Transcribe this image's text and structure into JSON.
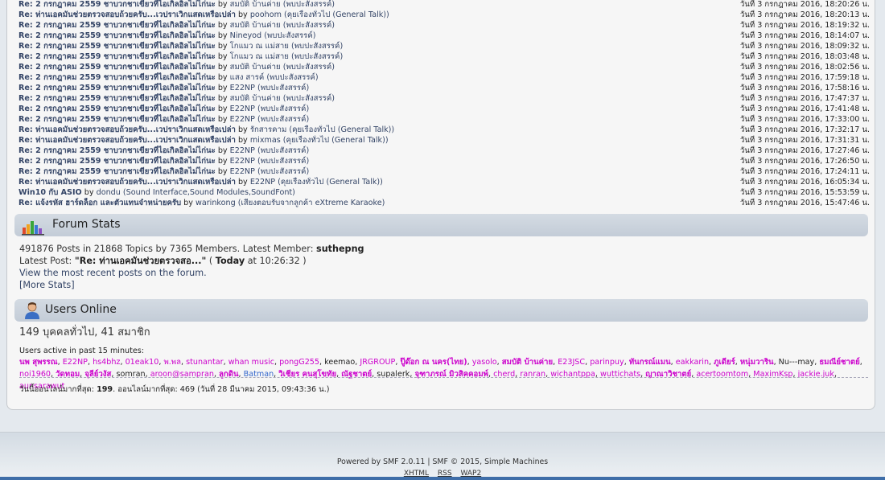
{
  "recent_posts": [
    {
      "title": "Re: 2 กรกฎาคม 2559 ชาบวกชาเขียวที่ไอเกิลอิลไม่ไก่นะ",
      "author": "สมบัติ บ้านค่าย",
      "board": "(พบปะสังสรรค์)",
      "time": "วันที่ 3 กรกฎาคม 2016, 18:20:26 น."
    },
    {
      "title": "Re: ท่านเอคมันช่วยตรวจสอบถ้วยครับ...เวปราเวิกแสดเหรือเปล่า",
      "author": "poohom",
      "board": "(คุยเรื่องทั่วไป (General Talk))",
      "time": "วันที่ 3 กรกฎาคม 2016, 18:20:13 น."
    },
    {
      "title": "Re: 2 กรกฎาคม 2559 ชาบวกชาเขียวที่ไอเกิลอิลไม่ไก่นะ",
      "author": "สมบัติ บ้านค่าย",
      "board": "(พบปะสังสรรค์)",
      "time": "วันที่ 3 กรกฎาคม 2016, 18:19:32 น."
    },
    {
      "title": "Re: 2 กรกฎาคม 2559 ชาบวกชาเขียวที่ไอเกิลอิลไม่ไก่นะ",
      "author": "Nineyod",
      "board": "(พบปะสังสรรค์)",
      "time": "วันที่ 3 กรกฎาคม 2016, 18:14:07 น."
    },
    {
      "title": "Re: 2 กรกฎาคม 2559 ชาบวกชาเขียวที่ไอเกิลอิลไม่ไก่นะ",
      "author": "โกแมว ณ แม่สาย",
      "board": "(พบปะสังสรรค์)",
      "time": "วันที่ 3 กรกฎาคม 2016, 18:09:32 น."
    },
    {
      "title": "Re: 2 กรกฎาคม 2559 ชาบวกชาเขียวที่ไอเกิลอิลไม่ไก่นะ",
      "author": "โกแมว ณ แม่สาย",
      "board": "(พบปะสังสรรค์)",
      "time": "วันที่ 3 กรกฎาคม 2016, 18:03:48 น."
    },
    {
      "title": "Re: 2 กรกฎาคม 2559 ชาบวกชาเขียวที่ไอเกิลอิลไม่ไก่นะ",
      "author": "สมบัติ บ้านค่าย",
      "board": "(พบปะสังสรรค์)",
      "time": "วันที่ 3 กรกฎาคม 2016, 18:02:56 น."
    },
    {
      "title": "Re: 2 กรกฎาคม 2559 ชาบวกชาเขียวที่ไอเกิลอิลไม่ไก่นะ",
      "author": "แสง สารค์",
      "board": "(พบปะสังสรรค์)",
      "time": "วันที่ 3 กรกฎาคม 2016, 17:59:18 น."
    },
    {
      "title": "Re: 2 กรกฎาคม 2559 ชาบวกชาเขียวที่ไอเกิลอิลไม่ไก่นะ",
      "author": "E22NP",
      "board": "(พบปะสังสรรค์)",
      "time": "วันที่ 3 กรกฎาคม 2016, 17:58:16 น."
    },
    {
      "title": "Re: 2 กรกฎาคม 2559 ชาบวกชาเขียวที่ไอเกิลอิลไม่ไก่นะ",
      "author": "สมบัติ บ้านค่าย",
      "board": "(พบปะสังสรรค์)",
      "time": "วันที่ 3 กรกฎาคม 2016, 17:47:37 น."
    },
    {
      "title": "Re: 2 กรกฎาคม 2559 ชาบวกชาเขียวที่ไอเกิลอิลไม่ไก่นะ",
      "author": "E22NP",
      "board": "(พบปะสังสรรค์)",
      "time": "วันที่ 3 กรกฎาคม 2016, 17:41:48 น."
    },
    {
      "title": "Re: 2 กรกฎาคม 2559 ชาบวกชาเขียวที่ไอเกิลอิลไม่ไก่นะ",
      "author": "E22NP",
      "board": "(พบปะสังสรรค์)",
      "time": "วันที่ 3 กรกฎาคม 2016, 17:33:00 น."
    },
    {
      "title": "Re: ท่านเอคมันช่วยตรวจสอบถ้วยครับ...เวปราเวิกแสดเหรือเปล่า",
      "author": "รักสารคาม",
      "board": "(คุยเรื่องทั่วไป (General Talk))",
      "time": "วันที่ 3 กรกฎาคม 2016, 17:32:17 น."
    },
    {
      "title": "Re: ท่านเอคมันช่วยตรวจสอบถ้วยครับ...เวปราเวิกแสดเหรือเปล่า",
      "author": "mixmas",
      "board": "(คุยเรื่องทั่วไป (General Talk))",
      "time": "วันที่ 3 กรกฎาคม 2016, 17:31:31 น."
    },
    {
      "title": "Re: 2 กรกฎาคม 2559 ชาบวกชาเขียวที่ไอเกิลอิลไม่ไก่นะ",
      "author": "E22NP",
      "board": "(พบปะสังสรรค์)",
      "time": "วันที่ 3 กรกฎาคม 2016, 17:27:46 น."
    },
    {
      "title": "Re: 2 กรกฎาคม 2559 ชาบวกชาเขียวที่ไอเกิลอิลไม่ไก่นะ",
      "author": "E22NP",
      "board": "(พบปะสังสรรค์)",
      "time": "วันที่ 3 กรกฎาคม 2016, 17:26:50 น."
    },
    {
      "title": "Re: 2 กรกฎาคม 2559 ชาบวกชาเขียวที่ไอเกิลอิลไม่ไก่นะ",
      "author": "E22NP",
      "board": "(พบปะสังสรรค์)",
      "time": "วันที่ 3 กรกฎาคม 2016, 17:24:11 น."
    },
    {
      "title": "Re: ท่านเอคมันช่วยตรวจสอบถ้วยครับ...เวปราเวิกแสดเหรือเปล่า",
      "author": "E22NP",
      "board": "(คุยเรื่องทั่วไป (General Talk))",
      "time": "วันที่ 3 กรกฎาคม 2016, 16:05:34 น."
    },
    {
      "title": "Win10 กับ ASIO",
      "author": "dondu",
      "board": "(Sound Interface,Sound Modules,SoundFont)",
      "time": "วันที่ 3 กรกฎาคม 2016, 15:53:59 น."
    },
    {
      "title": "Re: แจ้งรหัส ฮาร์ดล็อก และตัวแทนจำหน่ายครับ",
      "author": "warinkong",
      "board": "(เสียงตอบรับจากลูกค้า eXtreme Karaoke)",
      "time": "วันที่ 3 กรกฎาคม 2016, 15:47:46 น."
    }
  ],
  "by_word": "by",
  "forum_stats": {
    "title": "Forum Stats",
    "counts_line": "491876 Posts in 21868 Topics by 7365 Members. Latest Member:",
    "latest_member": "suthepng",
    "latest_post_label": "Latest Post:",
    "latest_post_title": "\"Re: ท่านเอคมันช่วยตรวจสอ...\"",
    "latest_post_paren_open": "(",
    "latest_post_day": "Today",
    "latest_post_time": "at 10:26:32 )",
    "recent_link": "View the most recent posts on the forum.",
    "more_stats": "[More Stats]"
  },
  "users_online": {
    "title": "Users Online",
    "count": "149 บุคคลทั่วไป, 41 สมาชิก",
    "active_label": "Users active in past 15 minutes:",
    "users": [
      {
        "name": "นพ สุพรรณ",
        "color": "#cc00cc",
        "bold": true
      },
      {
        "name": "E22NP",
        "color": "#cc00cc",
        "bold": false
      },
      {
        "name": "hs4bhz",
        "color": "#cc00cc",
        "bold": false
      },
      {
        "name": "01eak10",
        "color": "#cc00cc",
        "bold": false
      },
      {
        "name": "พ.พล",
        "color": "#cc00cc",
        "bold": false
      },
      {
        "name": "stunantar",
        "color": "#cc00cc",
        "bold": false
      },
      {
        "name": "whan music",
        "color": "#cc00cc",
        "bold": false
      },
      {
        "name": "pongG255",
        "color": "#cc00cc",
        "bold": false
      },
      {
        "name": "keemao",
        "color": "#222222",
        "bold": false
      },
      {
        "name": "JRGROUP",
        "color": "#cc00cc",
        "bold": false
      },
      {
        "name": "ปู๊ด๊อก ณ นคร(ไทย)",
        "color": "#cc00cc",
        "bold": true
      },
      {
        "name": "yasolo",
        "color": "#cc00cc",
        "bold": false
      },
      {
        "name": "สมบัติ บ้านค่าย",
        "color": "#cc00cc",
        "bold": true
      },
      {
        "name": "E23JSC",
        "color": "#cc00cc",
        "bold": false
      },
      {
        "name": "parinpuy",
        "color": "#cc00cc",
        "bold": false
      },
      {
        "name": "ทันกรณ์แมน",
        "color": "#cc00cc",
        "bold": true
      },
      {
        "name": "eakkarin",
        "color": "#cc00cc",
        "bold": false
      },
      {
        "name": "ภูเดียร์",
        "color": "#cc00cc",
        "bold": true
      },
      {
        "name": "หนุ่มวาริน",
        "color": "#cc00cc",
        "bold": true
      },
      {
        "name": "Nu---may",
        "color": "#222222",
        "bold": false
      },
      {
        "name": "ธมณีย์ชาตย์",
        "color": "#cc00cc",
        "bold": true
      },
      {
        "name": "noi1960",
        "color": "#cc00cc",
        "bold": false
      },
      {
        "name": "วัดทอม",
        "color": "#cc00cc",
        "bold": true
      },
      {
        "name": "จุลีย์วงัส",
        "color": "#cc00cc",
        "bold": true
      },
      {
        "name": "somran",
        "color": "#222222",
        "bold": false
      },
      {
        "name": "aroon@sampran",
        "color": "#cc00cc",
        "bold": false
      },
      {
        "name": "ลูกดิน",
        "color": "#cc00cc",
        "bold": true
      },
      {
        "name": "Batman",
        "color": "#3366cc",
        "bold": false
      },
      {
        "name": "วิเชียร คนสุโขทัย",
        "color": "#cc00cc",
        "bold": true
      },
      {
        "name": "ณัฐชาตย์",
        "color": "#cc00cc",
        "bold": true
      },
      {
        "name": "supalerk",
        "color": "#222222",
        "bold": false
      },
      {
        "name": "จุฑาภรณ์ มิวสิคคอมพ์",
        "color": "#cc00cc",
        "bold": true
      },
      {
        "name": "cherd",
        "color": "#cc00cc",
        "bold": false
      },
      {
        "name": "ranran",
        "color": "#cc00cc",
        "bold": false
      },
      {
        "name": "wichantppa",
        "color": "#cc00cc",
        "bold": false
      },
      {
        "name": "wuttichats",
        "color": "#cc00cc",
        "bold": false
      },
      {
        "name": "ญาณาวิชาตย์",
        "color": "#cc00cc",
        "bold": true
      },
      {
        "name": "acertoomtom",
        "color": "#cc00cc",
        "bold": false
      },
      {
        "name": "MaximKsp",
        "color": "#cc00cc",
        "bold": false
      },
      {
        "name": "jackie.juk",
        "color": "#cc00cc",
        "bold": false
      },
      {
        "name": "aunsarawut",
        "color": "#cc00cc",
        "bold": false
      }
    ],
    "record_prefix": "วันนี้ออนไลน์มากที่สุด:",
    "record_today": "199",
    "record_rest": ". ออนไลน์มากที่สุด: 469 (วันที่ 28 มีนาคม 2015, 09:43:36 น.)"
  },
  "footer": {
    "powered": "Powered by SMF 2.0.11 | SMF © 2015, Simple Machines",
    "links": [
      "XHTML",
      "RSS",
      "WAP2"
    ]
  },
  "icons": {
    "stats": "bar-chart-icon",
    "online": "user-icon"
  },
  "colors": {
    "link": "#334466",
    "member": "#cc00cc",
    "accent": "#3f6ea8"
  }
}
